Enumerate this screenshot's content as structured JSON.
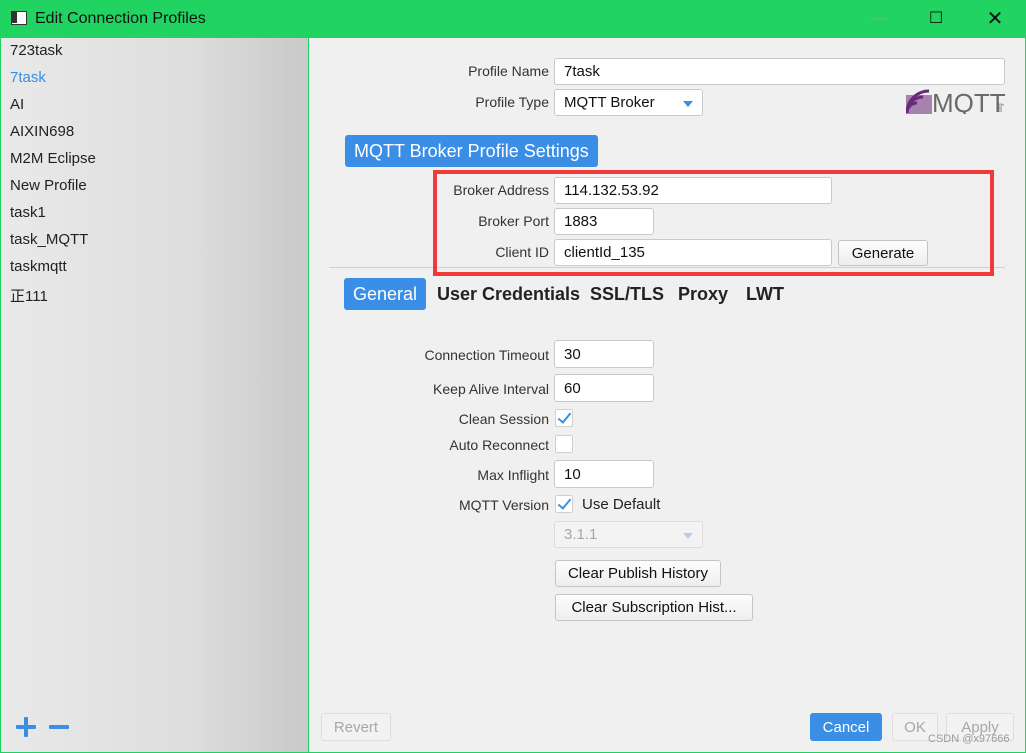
{
  "window": {
    "title": "Edit Connection Profiles",
    "min_glyph": "—",
    "max_glyph": "☐",
    "close_glyph": "✕"
  },
  "sidebar": {
    "items": [
      {
        "label": "723task",
        "selected": false
      },
      {
        "label": "7task",
        "selected": true
      },
      {
        "label": "AI",
        "selected": false
      },
      {
        "label": "AIXIN698",
        "selected": false
      },
      {
        "label": "M2M Eclipse",
        "selected": false
      },
      {
        "label": "New Profile",
        "selected": false
      },
      {
        "label": "task1",
        "selected": false
      },
      {
        "label": "task_MQTT",
        "selected": false
      },
      {
        "label": "taskmqtt",
        "selected": false
      },
      {
        "label": "正111",
        "selected": false
      }
    ],
    "add_icon": "plus-icon",
    "remove_icon": "minus-icon"
  },
  "profile": {
    "name_label": "Profile Name",
    "name_value": "7task",
    "type_label": "Profile Type",
    "type_value": "MQTT Broker",
    "logo_text": "MQTT",
    "logo_subtext": "org"
  },
  "broker": {
    "section_title": "MQTT Broker Profile Settings",
    "address_label": "Broker Address",
    "address_value": "114.132.53.92",
    "port_label": "Broker Port",
    "port_value": "1883",
    "client_id_label": "Client ID",
    "client_id_value": "clientId_135",
    "generate_label": "Generate"
  },
  "tabs": [
    {
      "label": "General",
      "active": true
    },
    {
      "label": "User Credentials",
      "active": false
    },
    {
      "label": "SSL/TLS",
      "active": false
    },
    {
      "label": "Proxy",
      "active": false
    },
    {
      "label": "LWT",
      "active": false
    }
  ],
  "general": {
    "connection_timeout_label": "Connection Timeout",
    "connection_timeout_value": "30",
    "keep_alive_label": "Keep Alive Interval",
    "keep_alive_value": "60",
    "clean_session_label": "Clean Session",
    "clean_session_checked": true,
    "auto_reconnect_label": "Auto Reconnect",
    "auto_reconnect_checked": false,
    "max_inflight_label": "Max Inflight",
    "max_inflight_value": "10",
    "mqtt_version_label": "MQTT Version",
    "use_default_label": "Use Default",
    "use_default_checked": true,
    "version_value": "3.1.1",
    "clear_publish_label": "Clear Publish History",
    "clear_subscription_label": "Clear Subscription Hist..."
  },
  "footer": {
    "revert_label": "Revert",
    "cancel_label": "Cancel",
    "ok_label": "OK",
    "apply_label": "Apply"
  },
  "watermark": "CSDN @x97666",
  "colors": {
    "accent": "#3a8ee6",
    "titlebar": "#21d462",
    "highlight": "#f03a3a"
  }
}
